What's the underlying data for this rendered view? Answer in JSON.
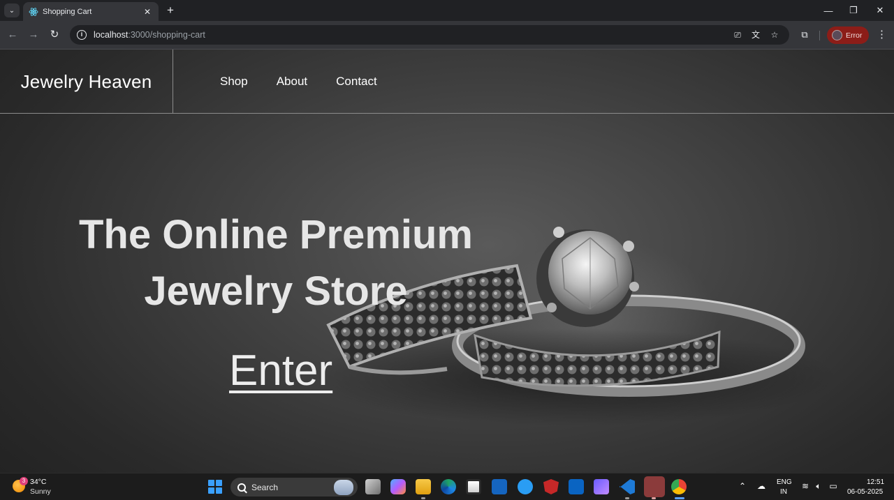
{
  "browser": {
    "tab_title": "Shopping Cart",
    "url_host": "localhost",
    "url_path": ":3000/shopping-cart",
    "profile_label": "Error"
  },
  "site": {
    "brand": "Jewelry Heaven",
    "nav": [
      "Shop",
      "About",
      "Contact"
    ],
    "hero_line1": "The Online Premium",
    "hero_line2": "Jewelry Store",
    "cta": "Enter"
  },
  "taskbar": {
    "weather_badge": "3",
    "weather_temp": "34°C",
    "weather_condition": "Sunny",
    "search_label": "Search",
    "lang_line1": "ENG",
    "lang_line2": "IN",
    "time": "12:51",
    "date": "06-05-2025"
  },
  "colors": {
    "profile_error": "#8c1d18",
    "chrome_dark": "#202124",
    "chrome_toolbar": "#35363a"
  }
}
